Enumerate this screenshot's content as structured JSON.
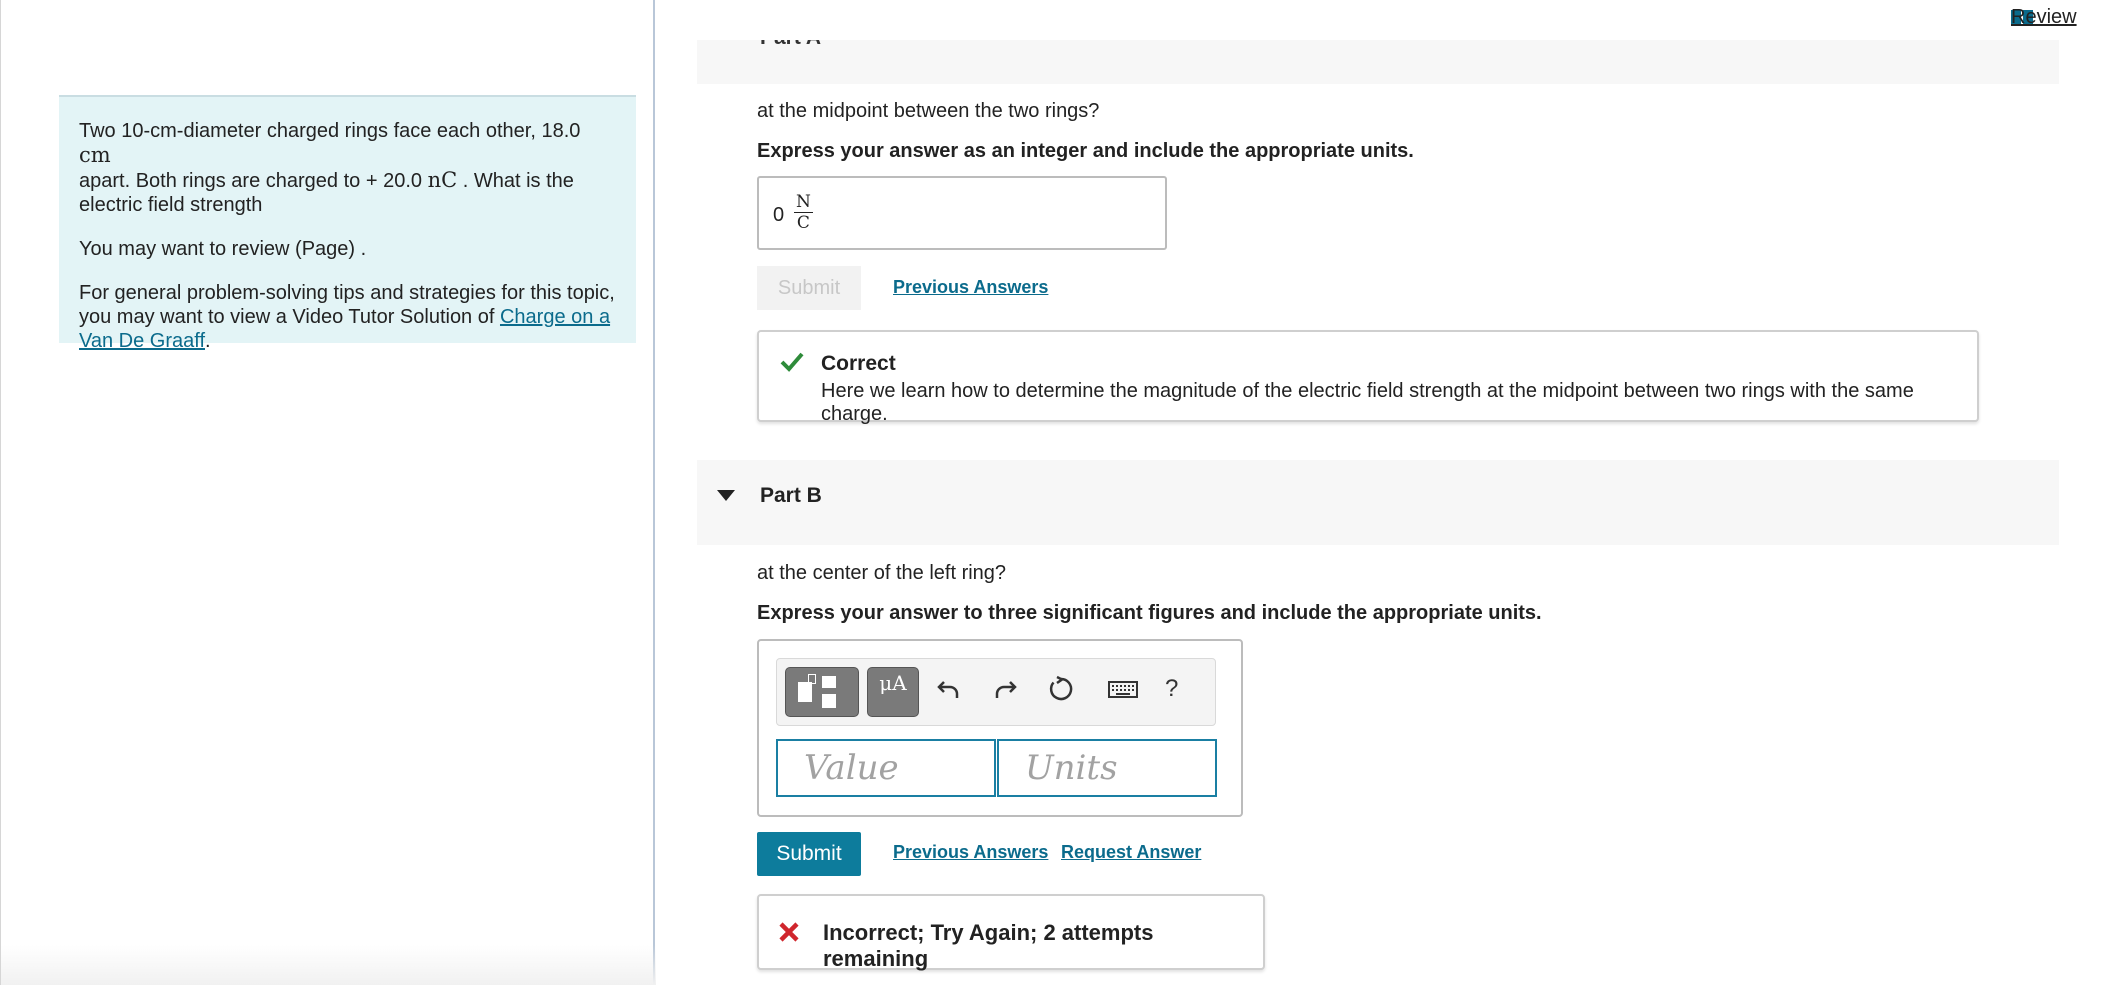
{
  "intro": {
    "line1_a": "Two 10-cm-diameter charged rings face each other, 18.0 ",
    "line1_unit": "cm",
    "line2_a": "apart. Both rings are charged to + 20.0 ",
    "line2_unit": "nC",
    "line2_b": " . What is the",
    "line3": "electric field strength",
    "review_text": "You may want to review (Page) .",
    "tips_text": "For general problem-solving tips and strategies for this topic, you may want to view a Video Tutor Solution of ",
    "tips_link": "Charge on a Van De Graaff",
    "tips_end": "."
  },
  "header": {
    "review_label": "Review",
    "part_a_cut": "Part A"
  },
  "part_a": {
    "question": "at the midpoint between the two rings?",
    "instruction": "Express your answer as an integer and include the appropriate units.",
    "answer_value": "0",
    "answer_unit_num": "N",
    "answer_unit_den": "C",
    "submit_label": "Submit",
    "previous_answers_label": "Previous Answers",
    "feedback_title": "Correct",
    "feedback_message": "Here we learn how to determine the magnitude of the electric field strength at the midpoint between two rings with the same charge."
  },
  "part_b": {
    "title": "Part B",
    "question": "at the center of the left ring?",
    "instruction": "Express your answer to three significant figures and include the appropriate units.",
    "toolbar": {
      "mu_label": "μA",
      "help_label": "?"
    },
    "value_placeholder": "Value",
    "units_placeholder": "Units",
    "submit_label": "Submit",
    "previous_answers_label": "Previous Answers",
    "request_answer_label": "Request Answer",
    "feedback_title": "Incorrect; Try Again; 2 attempts remaining"
  },
  "colors": {
    "accent": "#0d7c9c",
    "link": "#0b6b8c",
    "correct_green": "#2e8b3a",
    "incorrect_red": "#d0262d",
    "intro_bg": "#e3f4f6"
  }
}
